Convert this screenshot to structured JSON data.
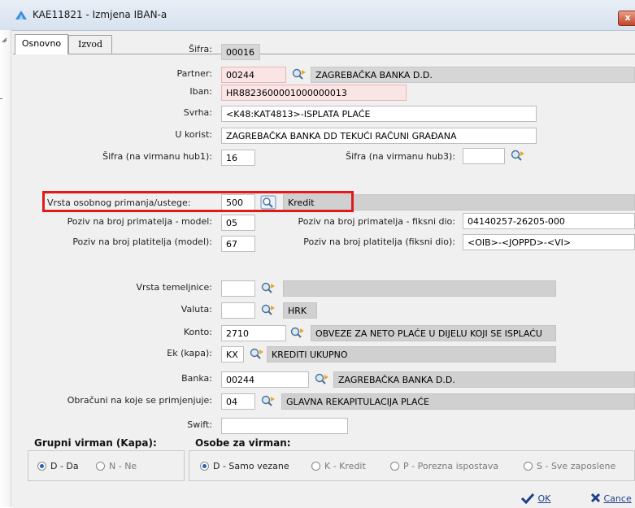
{
  "window": {
    "title": "KAE11821 - Izmjena IBAN-a",
    "close_label": "x"
  },
  "tabs": [
    {
      "label": "Osnovno"
    },
    {
      "label": "Izvod"
    }
  ],
  "form": {
    "sifra": {
      "label": "Šifra:",
      "value": "00016"
    },
    "partner": {
      "label": "Partner:",
      "code": "00244",
      "name": "ZAGREBAČKA BANKA D.D."
    },
    "iban": {
      "label": "Iban:",
      "value": "HR8823600001000000013"
    },
    "svrha": {
      "label": "Svrha:",
      "value": "<K48:KAT4813>-ISPLATA PLAĆE"
    },
    "u_korist": {
      "label": "U korist:",
      "value": "ZAGREBAČKA BANKA DD  TEKUĆI RAČUNI GRAĐANA"
    },
    "sifra_hub1": {
      "label": "Šifra (na virmanu hub1):",
      "value": "16"
    },
    "sifra_hub3": {
      "label": "Šifra (na virmanu hub3):",
      "value": ""
    },
    "vrsta_primanja": {
      "label": "Vrsta osobnog primanja/ustege:",
      "code": "500",
      "name": "Kredit"
    },
    "poziv_primatelja_model": {
      "label": "Poziv na broj primatelja - model:",
      "value": "05"
    },
    "poziv_primatelja_fiksni": {
      "label": "Poziv na broj primatelja - fiksni dio:",
      "value": "04140257-26205-000"
    },
    "poziv_platitelja_model": {
      "label": "Poziv na broj platitelja (model):",
      "value": "67"
    },
    "poziv_platitelja_fiksni": {
      "label": "Poziv na broj platitelja (fiksni dio):",
      "value": "<OIB>-<JOPPD>-<VI>"
    },
    "vrsta_temeljnice": {
      "label": "Vrsta temeljnice:",
      "code": "",
      "name": ""
    },
    "valuta": {
      "label": "Valuta:",
      "code": "",
      "name": "HRK"
    },
    "konto": {
      "label": "Konto:",
      "code": "2710",
      "name": "OBVEZE ZA NETO PLAĆE U DIJELU KOJI SE ISPLAĆU"
    },
    "ek": {
      "label": "Ek (kapa):",
      "code": "KX",
      "name": "KREDITI UKUPNO"
    },
    "banka": {
      "label": "Banka:",
      "code": "00244",
      "name": "ZAGREBAČKA BANKA D.D."
    },
    "obracuni": {
      "label": "Obračuni na koje se primjenjuje:",
      "code": "04",
      "name": "GLAVNA REKAPITULACIJA PLAĆE"
    },
    "swift": {
      "label": "Swift:",
      "value": ""
    }
  },
  "grupni_virman": {
    "title": "Grupni virman (Kapa):",
    "options": [
      {
        "label": "D - Da",
        "selected": true
      },
      {
        "label": "N - Ne",
        "selected": false
      }
    ]
  },
  "osobe_virman": {
    "title": "Osobe za virman:",
    "options": [
      {
        "label": "D - Samo vezane",
        "selected": true
      },
      {
        "label": "K - Kredit",
        "selected": false
      },
      {
        "label": "P - Porezna ispostava",
        "selected": false
      },
      {
        "label": "S - Sve zaposlene",
        "selected": false
      }
    ]
  },
  "footer": {
    "ok_label": "OK",
    "cancel_label": "Cance"
  },
  "colors": {
    "required_field": "#fbe4e4",
    "readonly_field": "#d6d6d6",
    "highlight": "#e01b1b",
    "link_blue": "#1f3e8a"
  }
}
